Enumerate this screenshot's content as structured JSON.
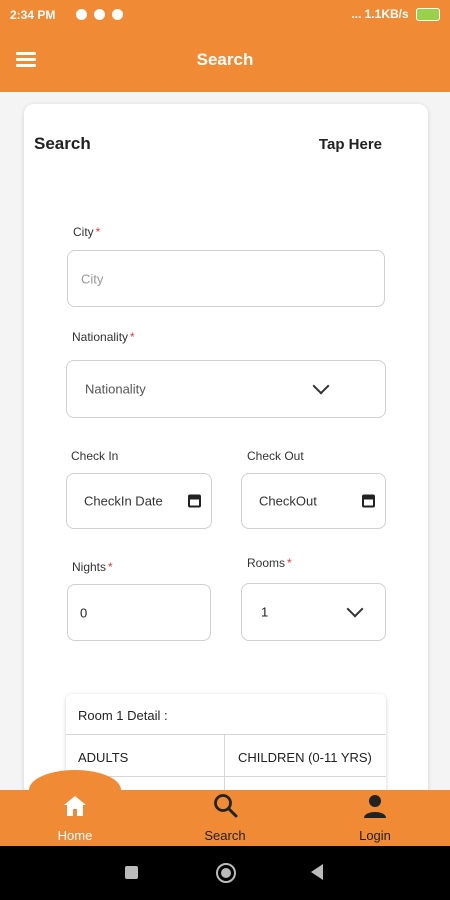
{
  "status_bar": {
    "time": "2:34 PM",
    "right_text": "... 1.1KB/s"
  },
  "app_bar": {
    "title": "Search"
  },
  "card": {
    "title": "Search",
    "tap_here": "Tap Here"
  },
  "form": {
    "city_label": "City",
    "city_placeholder": "City",
    "nationality_label": "Nationality",
    "nationality_value": "Nationality",
    "checkin_label": "Check In",
    "checkin_value": "CheckIn Date",
    "checkout_label": "Check Out",
    "checkout_value": "CheckOut",
    "nights_label": "Nights",
    "nights_value": "0",
    "rooms_label": "Rooms",
    "rooms_value": "1",
    "required_mark": "*"
  },
  "room_detail": {
    "title": "Room 1 Detail :",
    "col_adults": "ADULTS",
    "col_children": "CHILDREN (0-11 YRS)"
  },
  "bottom_nav": {
    "home": "Home",
    "search": "Search",
    "login": "Login"
  },
  "colors": {
    "accent": "#f08a34",
    "required": "#e53935"
  }
}
